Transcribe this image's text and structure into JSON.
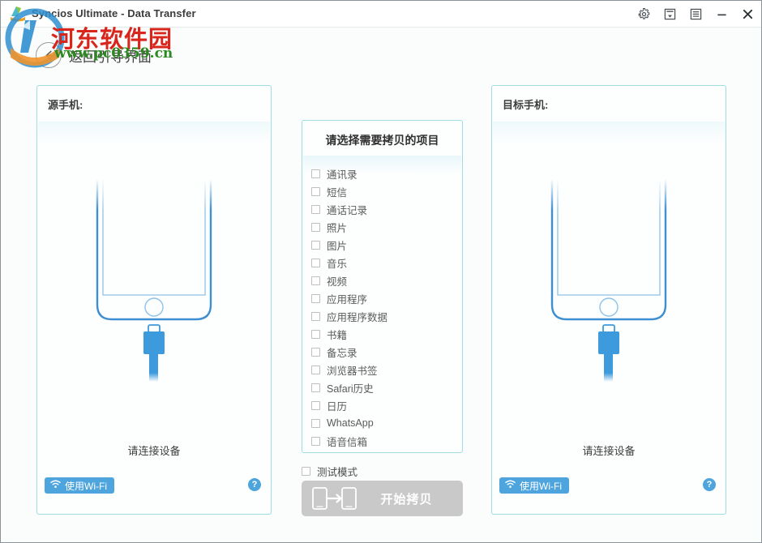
{
  "window": {
    "app_title": "Syncios Ultimate - Data Transfer",
    "app_icon": "app-logo-icon",
    "controls": [
      {
        "name": "settings",
        "icon": "gear-icon",
        "glyph": "⚙"
      },
      {
        "name": "feedback",
        "icon": "feedback-icon",
        "glyph": "▤"
      },
      {
        "name": "menu",
        "icon": "menu-icon",
        "glyph": "▤"
      },
      {
        "name": "minimize",
        "icon": "minimize-icon",
        "glyph": "—"
      },
      {
        "name": "close",
        "icon": "close-icon",
        "glyph": "✕"
      }
    ]
  },
  "watermark": {
    "site_name": "河东软件园",
    "site_url": "www.pc0359.cn",
    "name_color": "#d9261c",
    "url_color": "#2a8a1f"
  },
  "back": {
    "icon": "arrow-left-icon",
    "label": "返回引导界面"
  },
  "source_panel": {
    "title": "源手机:",
    "status": "请连接设备",
    "wifi_button": "使用Wi-Fi",
    "wifi_icon": "wifi-icon",
    "help_icon": "help-icon",
    "help_glyph": "?"
  },
  "target_panel": {
    "title": "目标手机:",
    "status": "请连接设备",
    "wifi_button": "使用Wi-Fi",
    "wifi_icon": "wifi-icon",
    "help_icon": "help-icon",
    "help_glyph": "?"
  },
  "center_panel": {
    "title": "请选择需要拷贝的项目",
    "items": [
      {
        "label": "通讯录",
        "checked": false
      },
      {
        "label": "短信",
        "checked": false
      },
      {
        "label": "通话记录",
        "checked": false
      },
      {
        "label": "照片",
        "checked": false
      },
      {
        "label": "图片",
        "checked": false
      },
      {
        "label": "音乐",
        "checked": false
      },
      {
        "label": "视频",
        "checked": false
      },
      {
        "label": "应用程序",
        "checked": false
      },
      {
        "label": "应用程序数据",
        "checked": false
      },
      {
        "label": "书籍",
        "checked": false
      },
      {
        "label": "备忘录",
        "checked": false
      },
      {
        "label": "浏览器书签",
        "checked": false
      },
      {
        "label": "Safari历史",
        "checked": false
      },
      {
        "label": "日历",
        "checked": false
      },
      {
        "label": "WhatsApp",
        "checked": false
      },
      {
        "label": "语音信箱",
        "checked": false
      }
    ]
  },
  "actions": {
    "test_mode_label": "测试模式",
    "test_mode_checked": false,
    "copy_button_label": "开始拷贝",
    "copy_button_icon": "phone-transfer-icon",
    "copy_button_enabled": false
  },
  "colors": {
    "accent_blue": "#4ea5dd",
    "panel_border": "#9fdde3",
    "phone_outline": "#3d8fd1",
    "disabled_gray": "#c9c9c9"
  }
}
